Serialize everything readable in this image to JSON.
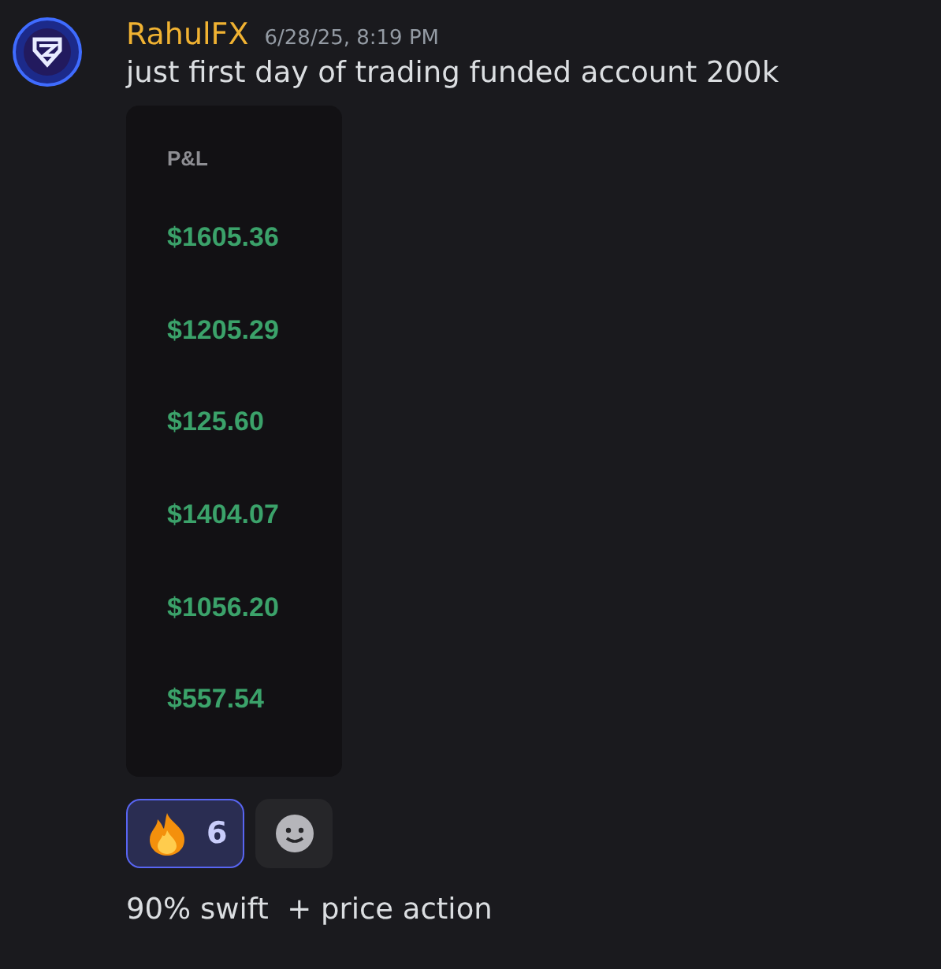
{
  "message": {
    "author": "RahulFX",
    "timestamp": "6/28/25, 8:19 PM",
    "text": "just first day of trading funded account 200k"
  },
  "attachment": {
    "header": "P&L",
    "values": [
      "$1605.36",
      "$1205.29",
      "$125.60",
      "$1404.07",
      "$1056.20",
      "$557.54"
    ]
  },
  "reactions": [
    {
      "count": "6",
      "selected": true
    }
  ],
  "followup": "90% swift  + price action"
}
